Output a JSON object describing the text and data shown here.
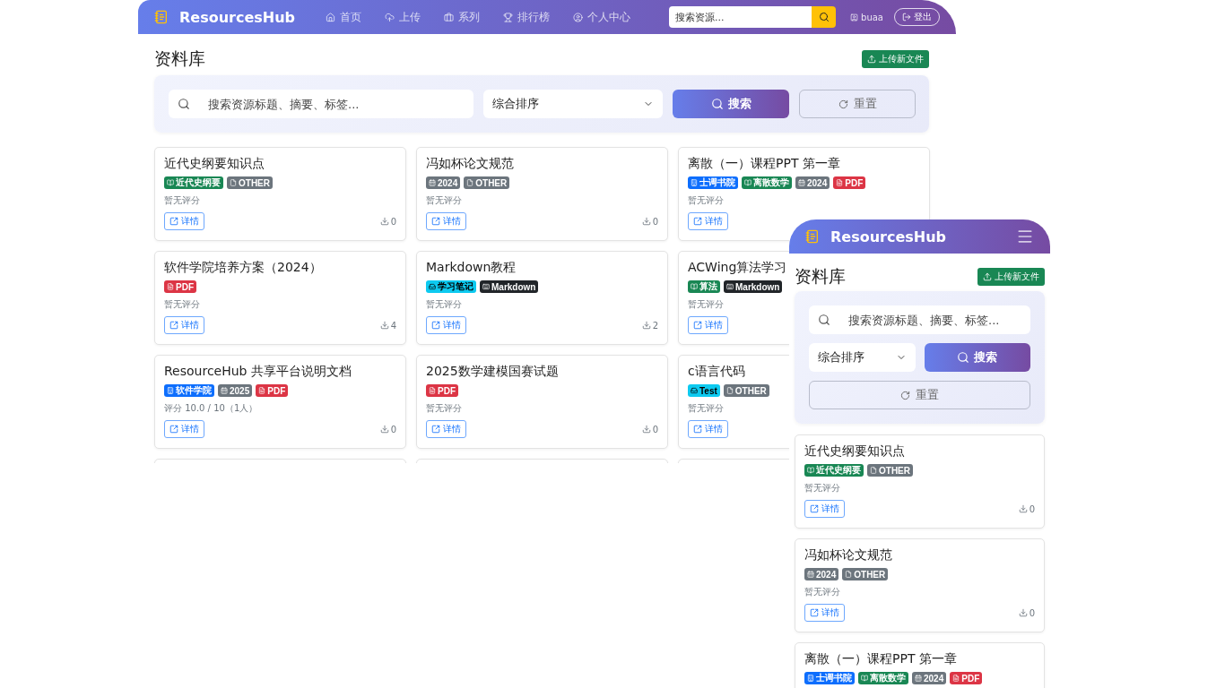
{
  "desktop": {
    "header": {
      "brand": "ResourcesHub",
      "nav": [
        {
          "label": "首页"
        },
        {
          "label": "上传"
        },
        {
          "label": "系列"
        },
        {
          "label": "排行榜"
        },
        {
          "label": "个人中心"
        }
      ],
      "search": {
        "placeholder": "搜索资源..."
      },
      "user": "buaa",
      "logout": "登出"
    },
    "page_title": "资料库",
    "upload": "上传新文件",
    "filters": {
      "placeholder": "搜索资源标题、摘要、标签...",
      "sort": "综合排序",
      "search": "搜索",
      "reset": "重置"
    },
    "cards": [
      {
        "title": "近代史纲要知识点",
        "tags": [
          {
            "label": "近代史纲要",
            "kind": "course"
          },
          {
            "label": "OTHER",
            "kind": "other"
          }
        ],
        "rating": "暂无评分",
        "detail": "详情",
        "downloads": "0"
      },
      {
        "title": "冯如杯论文规范",
        "tags": [
          {
            "label": "2024",
            "kind": "year"
          },
          {
            "label": "OTHER",
            "kind": "other"
          }
        ],
        "rating": "暂无评分",
        "detail": "详情",
        "downloads": "0"
      },
      {
        "title": "离散（一）课程PPT 第一章",
        "tags": [
          {
            "label": "士谔书院",
            "kind": "college"
          },
          {
            "label": "离散数学",
            "kind": "course"
          },
          {
            "label": "2024",
            "kind": "year"
          },
          {
            "label": "PDF",
            "kind": "pdf"
          }
        ],
        "rating": "暂无评分",
        "detail": "详情"
      },
      {
        "title": "软件学院培养方案（2024）",
        "tags": [
          {
            "label": "PDF",
            "kind": "pdf"
          }
        ],
        "rating": "暂无评分",
        "detail": "详情",
        "downloads": "4"
      },
      {
        "title": "Markdown教程",
        "tags": [
          {
            "label": "学习笔记",
            "kind": "series"
          },
          {
            "label": "Markdown",
            "kind": "markdown"
          }
        ],
        "rating": "暂无评分",
        "detail": "详情",
        "downloads": "2"
      },
      {
        "title": "ACWing算法学习",
        "tags": [
          {
            "label": "算法",
            "kind": "course"
          },
          {
            "label": "Markdown",
            "kind": "markdown"
          }
        ],
        "rating": "暂无评分",
        "detail": "详情"
      },
      {
        "title": "ResourceHub 共享平台说明文档",
        "tags": [
          {
            "label": "软件学院",
            "kind": "college"
          },
          {
            "label": "2025",
            "kind": "year"
          },
          {
            "label": "PDF",
            "kind": "pdf"
          }
        ],
        "rating": "评分 10.0 / 10（1人）",
        "detail": "详情",
        "downloads": "0"
      },
      {
        "title": "2025数学建模国赛试题",
        "tags": [
          {
            "label": "PDF",
            "kind": "pdf"
          }
        ],
        "rating": "暂无评分",
        "detail": "详情",
        "downloads": "0"
      },
      {
        "title": "c语言代码",
        "tags": [
          {
            "label": "Test",
            "kind": "series"
          },
          {
            "label": "OTHER",
            "kind": "other"
          }
        ],
        "rating": "暂无评分",
        "detail": "详情"
      }
    ]
  },
  "mobile": {
    "header": {
      "brand": "ResourcesHub"
    },
    "page_title": "资料库",
    "upload": "上传新文件",
    "filters": {
      "placeholder": "搜索资源标题、摘要、标签...",
      "sort": "综合排序",
      "search": "搜索",
      "reset": "重置"
    },
    "cards": [
      {
        "title": "近代史纲要知识点",
        "tags": [
          {
            "label": "近代史纲要",
            "kind": "course"
          },
          {
            "label": "OTHER",
            "kind": "other"
          }
        ],
        "rating": "暂无评分",
        "detail": "详情",
        "downloads": "0"
      },
      {
        "title": "冯如杯论文规范",
        "tags": [
          {
            "label": "2024",
            "kind": "year"
          },
          {
            "label": "OTHER",
            "kind": "other"
          }
        ],
        "rating": "暂无评分",
        "detail": "详情",
        "downloads": "0"
      },
      {
        "title": "离散（一）课程PPT 第一章",
        "tags": [
          {
            "label": "士谔书院",
            "kind": "college"
          },
          {
            "label": "离散数学",
            "kind": "course"
          },
          {
            "label": "2024",
            "kind": "year"
          },
          {
            "label": "PDF",
            "kind": "pdf"
          }
        ]
      }
    ]
  }
}
